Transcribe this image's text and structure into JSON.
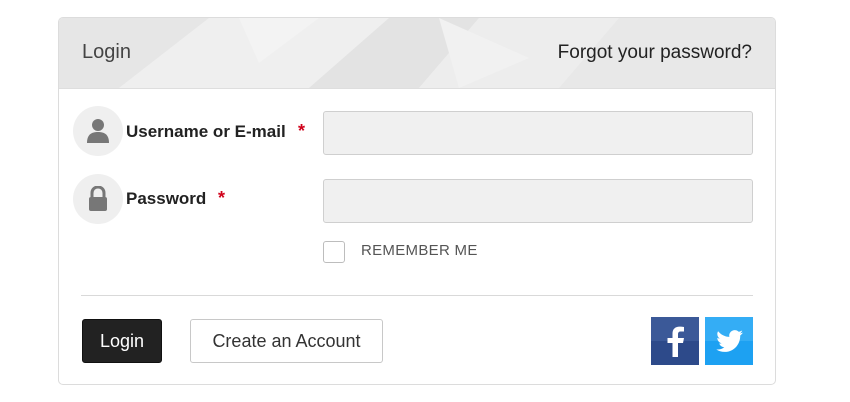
{
  "header": {
    "title": "Login",
    "forgot_link": "Forgot your password?"
  },
  "fields": {
    "username": {
      "label": "Username or E-mail",
      "required_mark": "*",
      "icon": "user-icon",
      "value": "",
      "placeholder": ""
    },
    "password": {
      "label": "Password",
      "required_mark": "*",
      "icon": "lock-icon",
      "value": "",
      "placeholder": ""
    }
  },
  "remember": {
    "label": "REMEMBER ME",
    "checked": false
  },
  "buttons": {
    "login_label": "Login",
    "create_label": "Create an Account"
  },
  "social": [
    {
      "name": "facebook",
      "icon": "facebook-icon",
      "color": "#3b5998"
    },
    {
      "name": "twitter",
      "icon": "twitter-icon",
      "color": "#1da1f2"
    }
  ],
  "colors": {
    "required": "#d0021b",
    "login_button": "#222222",
    "header_bg": "#ebebeb"
  }
}
